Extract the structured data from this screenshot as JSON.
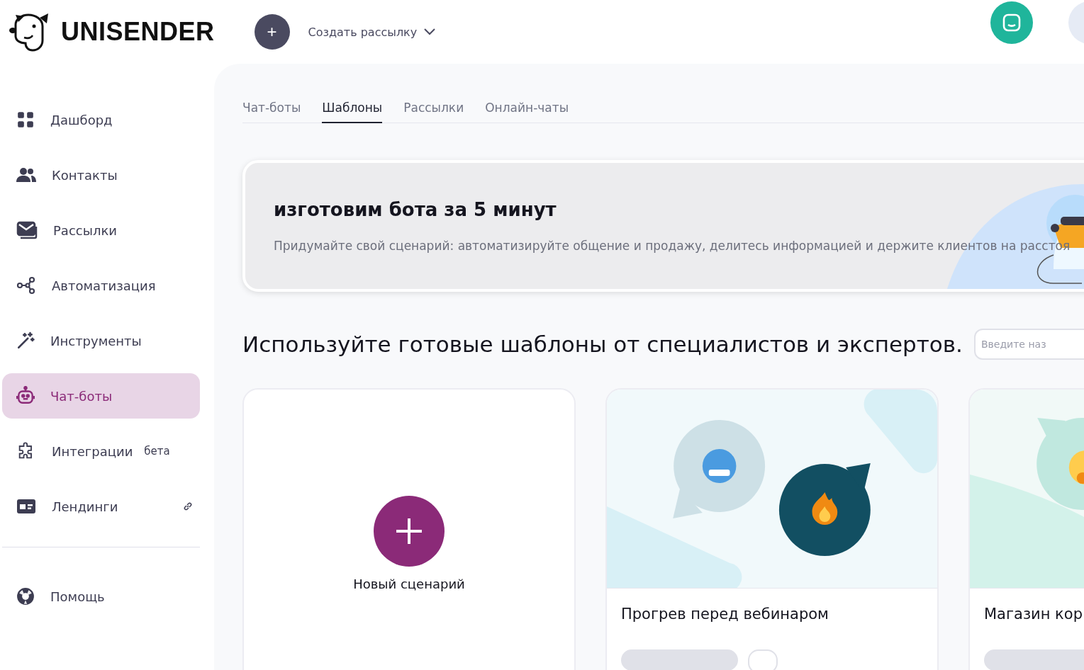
{
  "header": {
    "logo": "UNISENDER",
    "create_button": "+",
    "create_menu": "Создать рассылку"
  },
  "sidebar": {
    "items": [
      {
        "label": "Дашборд",
        "selected": false,
        "kind": "plain"
      },
      {
        "label": "Контакты",
        "selected": false,
        "kind": "plain"
      },
      {
        "label": "Рассылки",
        "selected": false,
        "kind": "plain"
      },
      {
        "label": "Автоматизация",
        "selected": false,
        "kind": "plain"
      },
      {
        "label": "Инструменты",
        "selected": false,
        "kind": "plain"
      },
      {
        "label": "Чат-боты",
        "selected": true,
        "kind": "plain"
      },
      {
        "label": "Интеграции",
        "selected": false,
        "kind": "beta",
        "badge": "бета"
      },
      {
        "label": "Лендинги",
        "selected": false,
        "kind": "external"
      }
    ],
    "help": "Помощь"
  },
  "tabs": [
    {
      "label": "Чат-боты",
      "selected": false
    },
    {
      "label": "Шаблоны",
      "selected": true
    },
    {
      "label": "Рассылки",
      "selected": false
    },
    {
      "label": "Онлайн-чаты",
      "selected": false
    }
  ],
  "banner": {
    "title": "изготовим бота за 5 минут",
    "text": "Придумайте свой сценарий: автоматизируйте общение и продажу, делитесь информацией и держите клиентов на расстоя"
  },
  "heading": "Используйте готовые шаблоны от специалистов и экспертов.",
  "search": {
    "placeholder": "Введите наз"
  },
  "cards": [
    {
      "kind": "new",
      "label": "Новый сценарий"
    },
    {
      "kind": "warmup",
      "title": "Прогрев перед вебинаром"
    },
    {
      "kind": "shop",
      "title": "Магазин кор"
    }
  ]
}
